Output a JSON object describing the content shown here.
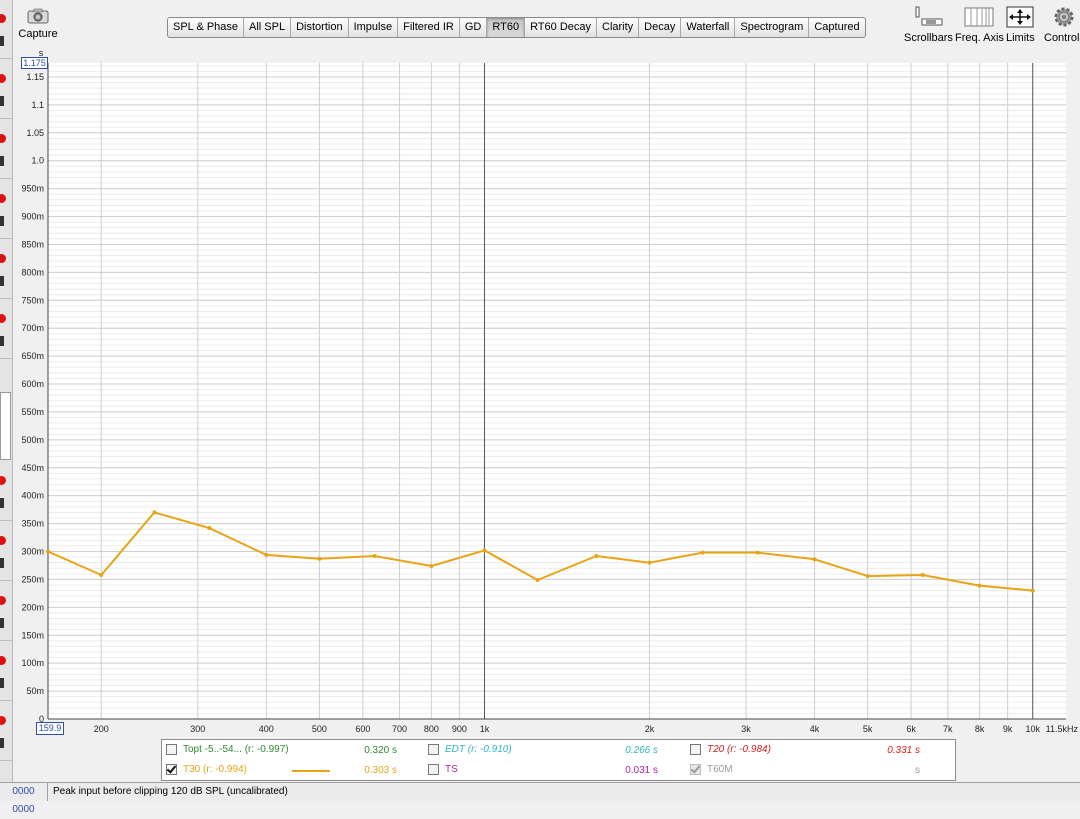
{
  "toolbar": {
    "capture_label": "Capture",
    "tabs": [
      {
        "label": "SPL & Phase"
      },
      {
        "label": "All SPL"
      },
      {
        "label": "Distortion"
      },
      {
        "label": "Impulse"
      },
      {
        "label": "Filtered IR"
      },
      {
        "label": "GD"
      },
      {
        "label": "RT60",
        "active": true
      },
      {
        "label": "RT60 Decay"
      },
      {
        "label": "Clarity"
      },
      {
        "label": "Decay"
      },
      {
        "label": "Waterfall"
      },
      {
        "label": "Spectrogram"
      },
      {
        "label": "Captured"
      }
    ],
    "tools": {
      "scrollbars": "Scrollbars",
      "freq_axis": "Freq. Axis",
      "limits": "Limits",
      "controls": "Controls"
    }
  },
  "chart_data": {
    "type": "line",
    "ylabel": "s",
    "ylim": [
      0,
      1.175
    ],
    "y_ticks": [
      "50m",
      "100m",
      "150m",
      "200m",
      "250m",
      "300m",
      "350m",
      "400m",
      "450m",
      "500m",
      "550m",
      "600m",
      "650m",
      "700m",
      "750m",
      "800m",
      "850m",
      "900m",
      "950m",
      "1.0",
      "1.05",
      "1.1",
      "1.15"
    ],
    "y_tick_values": [
      0.05,
      0.1,
      0.15,
      0.2,
      0.25,
      0.3,
      0.35,
      0.4,
      0.45,
      0.5,
      0.55,
      0.6,
      0.65,
      0.7,
      0.75,
      0.8,
      0.85,
      0.9,
      0.95,
      1.0,
      1.05,
      1.1,
      1.15
    ],
    "y_zero_label": "0",
    "y_top_handle": "1.175",
    "xscale": "log",
    "xlim": [
      159.9,
      11500
    ],
    "x_start_handle": "159.9",
    "x_ticks": [
      {
        "value": 200,
        "label": "200"
      },
      {
        "value": 300,
        "label": "300"
      },
      {
        "value": 400,
        "label": "400"
      },
      {
        "value": 500,
        "label": "500"
      },
      {
        "value": 600,
        "label": "600"
      },
      {
        "value": 700,
        "label": "700"
      },
      {
        "value": 800,
        "label": "800"
      },
      {
        "value": 900,
        "label": "900"
      },
      {
        "value": 1000,
        "label": "1k"
      },
      {
        "value": 2000,
        "label": "2k"
      },
      {
        "value": 3000,
        "label": "3k"
      },
      {
        "value": 4000,
        "label": "4k"
      },
      {
        "value": 5000,
        "label": "5k"
      },
      {
        "value": 6000,
        "label": "6k"
      },
      {
        "value": 7000,
        "label": "7k"
      },
      {
        "value": 8000,
        "label": "8k"
      },
      {
        "value": 9000,
        "label": "9k"
      },
      {
        "value": 10000,
        "label": "10k"
      }
    ],
    "x_end_label": "11.5kHz",
    "series": [
      {
        "name": "T30",
        "color": "#e8a317",
        "x": [
          159.9,
          200,
          250,
          315,
          400,
          500,
          630,
          800,
          1000,
          1250,
          1600,
          2000,
          2500,
          3150,
          4000,
          5000,
          6300,
          8000,
          10000
        ],
        "values": [
          0.3,
          0.258,
          0.37,
          0.342,
          0.294,
          0.287,
          0.292,
          0.274,
          0.302,
          0.249,
          0.292,
          0.28,
          0.298,
          0.298,
          0.286,
          0.256,
          0.258,
          0.239,
          0.23
        ]
      }
    ],
    "grid": true
  },
  "legend": {
    "topt_label": "Topt -5..-54... (r: -0.997)",
    "topt_value": "0.320 s",
    "edt_label": "EDT (r: -0.910)",
    "edt_value": "0.266 s",
    "t20_label": "T20 (r: -0.984)",
    "t20_value": "0.331 s",
    "t30_label": "T30 (r: -0.994)",
    "t30_value": "0.303 s",
    "ts_label": "TS",
    "ts_value": "0.031 s",
    "t60m_label": "T60M",
    "t60m_value": "s",
    "colors": {
      "topt": "#2e8b2e",
      "edt": "#2fb7c6",
      "t20": "#d62020",
      "t30": "#e8a317",
      "ts": "#b020b0",
      "t60m": "#9a9a9a"
    }
  },
  "status": {
    "left_text": "0000 0000",
    "message": "Peak input before clipping 120 dB SPL (uncalibrated)"
  }
}
